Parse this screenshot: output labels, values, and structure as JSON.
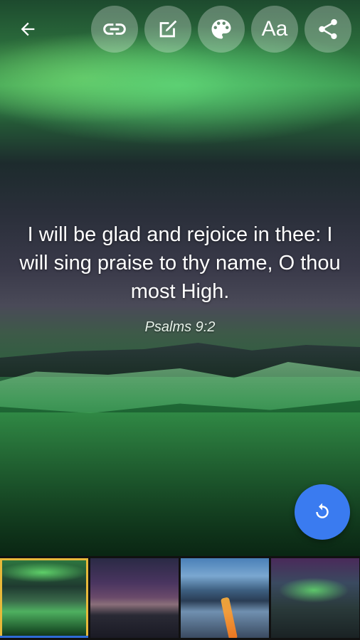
{
  "verse": {
    "text": "I will be glad and rejoice in thee: I will sing praise to thy name, O thou most High.",
    "reference": "Psalms 9:2"
  },
  "toolbar": {
    "font_button_label": "Aa",
    "buttons": [
      "link-icon",
      "edit-icon",
      "palette-icon",
      "font-icon",
      "share-icon"
    ]
  },
  "icons": {
    "back": "arrow-left-icon",
    "refresh": "refresh-icon"
  },
  "colors": {
    "fab": "#3a7bf0",
    "selected_thumb_border": "#e8b93a",
    "toolbar_button_bg": "rgba(255,255,255,0.28)"
  },
  "thumbnails": [
    {
      "name": "aurora-lake",
      "selected": true
    },
    {
      "name": "dusk-mountain",
      "selected": false
    },
    {
      "name": "coast-road",
      "selected": false
    },
    {
      "name": "aurora-night",
      "selected": false
    }
  ]
}
